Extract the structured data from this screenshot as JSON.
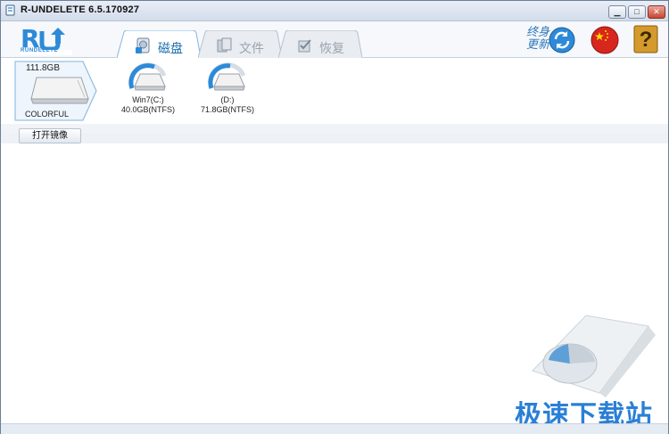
{
  "window": {
    "title": "R-UNDELETE 6.5.170927",
    "controls": {
      "minimize": "▁",
      "maximize": "□",
      "close": "✕"
    }
  },
  "logo": {
    "text": "RUNDELETE",
    "icon": "r-undelete-logo"
  },
  "tabs": [
    {
      "label": "磁盘",
      "icon": "disk-icon",
      "active": true
    },
    {
      "label": "文件",
      "icon": "files-icon",
      "active": false
    },
    {
      "label": "恢复",
      "icon": "recover-icon",
      "active": false
    }
  ],
  "toolbar": {
    "update_line1": "终身",
    "update_line2": "更新",
    "update_icon": "refresh-icon",
    "language_icon": "china-flag-icon",
    "help_icon": "help-icon",
    "help_label": "?"
  },
  "disk": {
    "size": "111.8GB",
    "name": "COLORFUL"
  },
  "partitions": [
    {
      "name": "Win7(C:)",
      "size": "40.0GB(NTFS)"
    },
    {
      "name": "(D:)",
      "size": "71.8GB(NTFS)"
    }
  ],
  "actions": {
    "open_image": "打开镜像"
  },
  "watermark": {
    "text": "极速下载站"
  },
  "colors": {
    "accent": "#2d8ad8",
    "active_tab_text": "#1c6fb0",
    "title_bg": "#d3dcea"
  }
}
